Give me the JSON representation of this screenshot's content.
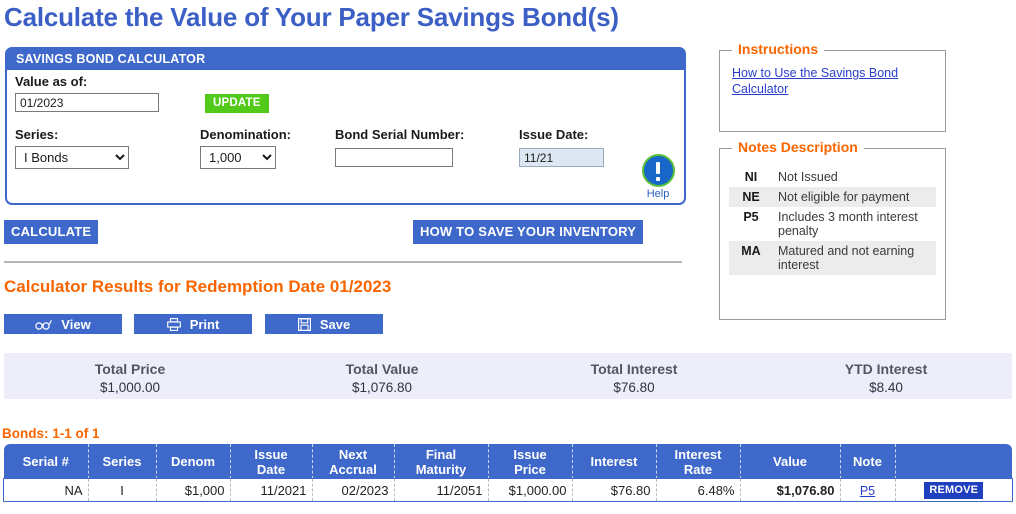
{
  "page": {
    "title": "Calculate the Value of Your Paper Savings Bond(s)"
  },
  "calculator": {
    "header": "SAVINGS BOND CALCULATOR",
    "value_as_of_label": "Value as of:",
    "value_as_of_value": "01/2023",
    "update_label": "UPDATE",
    "help_label": "Help",
    "series_label": "Series:",
    "series_value": "I Bonds",
    "series_options": [
      "I Bonds"
    ],
    "denomination_label": "Denomination:",
    "denomination_value": "1,000",
    "denomination_options": [
      "1,000"
    ],
    "serial_label": "Bond Serial Number:",
    "serial_value": "",
    "issue_date_label": "Issue Date:",
    "issue_date_value": "11/21"
  },
  "actions": {
    "calculate_label": "CALCULATE",
    "how_to_save_label": "HOW TO SAVE YOUR INVENTORY"
  },
  "results": {
    "title": "Calculator Results for Redemption Date 01/2023",
    "view_label": "View",
    "print_label": "Print",
    "save_label": "Save"
  },
  "totals": [
    {
      "label": "Total Price",
      "value": "$1,000.00"
    },
    {
      "label": "Total Value",
      "value": "$1,076.80"
    },
    {
      "label": "Total Interest",
      "value": "$76.80"
    },
    {
      "label": "YTD Interest",
      "value": "$8.40"
    }
  ],
  "bonds": {
    "count_label": "Bonds: 1-1 of 1",
    "columns": [
      "Serial #",
      "Series",
      "Denom",
      "Issue Date",
      "Next Accrual",
      "Final Maturity",
      "Issue Price",
      "Interest",
      "Interest Rate",
      "Value",
      "Note",
      ""
    ],
    "columns_split": [
      [
        "Serial #"
      ],
      [
        "Series"
      ],
      [
        "Denom"
      ],
      [
        "Issue",
        "Date"
      ],
      [
        "Next",
        "Accrual"
      ],
      [
        "Final",
        "Maturity"
      ],
      [
        "Issue",
        "Price"
      ],
      [
        "Interest"
      ],
      [
        "Interest",
        "Rate"
      ],
      [
        "Value"
      ],
      [
        "Note"
      ],
      [
        ""
      ]
    ],
    "rows": [
      {
        "serial": "NA",
        "series": "I",
        "denom": "$1,000",
        "issue_date": "11/2021",
        "next_accrual": "02/2023",
        "final_maturity": "11/2051",
        "issue_price": "$1,000.00",
        "interest": "$76.80",
        "interest_rate": "6.48%",
        "value": "$1,076.80",
        "note": "P5",
        "remove_label": "REMOVE"
      }
    ]
  },
  "instructions": {
    "legend": "Instructions",
    "link": "How to Use the Savings Bond Calculator"
  },
  "notes": {
    "legend": "Notes Description",
    "items": [
      {
        "code": "NI",
        "desc": "Not Issued"
      },
      {
        "code": "NE",
        "desc": "Not eligible for payment"
      },
      {
        "code": "P5",
        "desc": "Includes 3 month interest penalty"
      },
      {
        "code": "MA",
        "desc": "Matured and not earning interest"
      }
    ]
  },
  "colors": {
    "brand_blue": "#3e68c9",
    "title_blue": "#3b5fc4",
    "orange": "#f96500",
    "green": "#53c91a",
    "remove_blue": "#1f3fbf",
    "totals_bg": "#eeeefb"
  }
}
